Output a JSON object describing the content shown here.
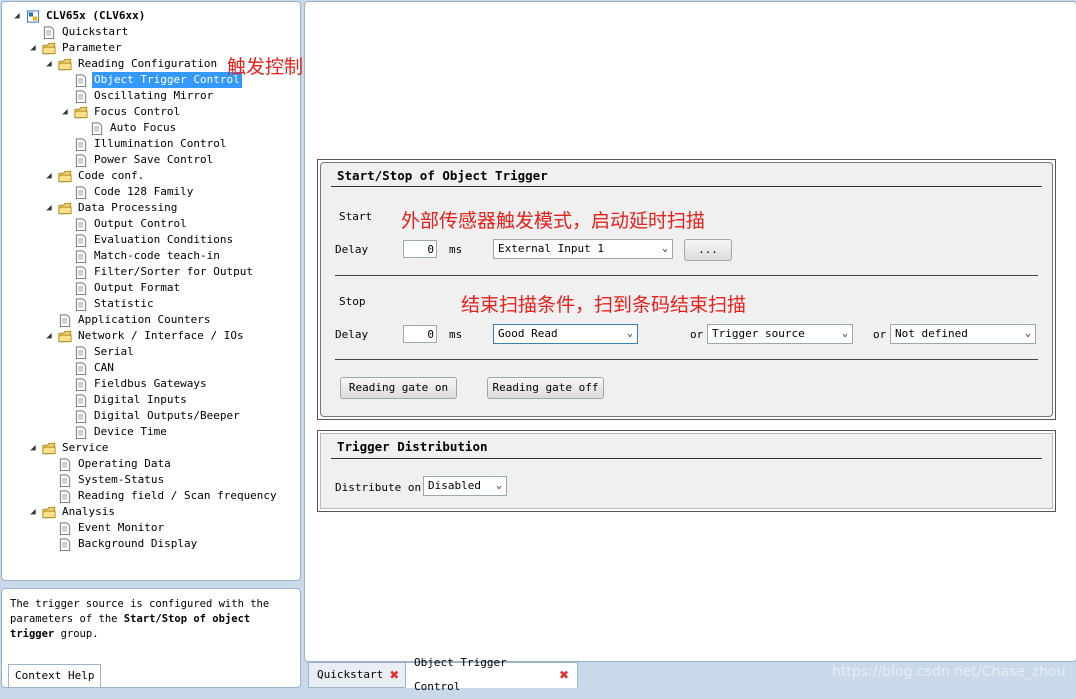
{
  "tree": [
    {
      "label": "CLV65x (CLV6xx)",
      "level": 0,
      "icon": "device-icon",
      "toggle": "expanded",
      "bold": true
    },
    {
      "label": "Quickstart",
      "level": 1,
      "icon": "page-icon",
      "toggle": "none"
    },
    {
      "label": "Parameter",
      "level": 1,
      "icon": "folder-icon",
      "toggle": "expanded"
    },
    {
      "label": "Reading Configuration",
      "level": 2,
      "icon": "folder-icon",
      "toggle": "expanded"
    },
    {
      "label": "Object Trigger Control",
      "level": 3,
      "icon": "page-icon",
      "toggle": "none",
      "selected": true
    },
    {
      "label": "Oscillating Mirror",
      "level": 3,
      "icon": "page-icon",
      "toggle": "none"
    },
    {
      "label": "Focus Control",
      "level": 3,
      "icon": "folder-icon",
      "toggle": "expanded"
    },
    {
      "label": "Auto Focus",
      "level": 4,
      "icon": "page-icon",
      "toggle": "none"
    },
    {
      "label": "Illumination Control",
      "level": 3,
      "icon": "page-icon",
      "toggle": "none"
    },
    {
      "label": "Power Save Control",
      "level": 3,
      "icon": "page-icon",
      "toggle": "none"
    },
    {
      "label": "Code conf.",
      "level": 2,
      "icon": "folder-icon",
      "toggle": "expanded"
    },
    {
      "label": "Code 128 Family",
      "level": 3,
      "icon": "page-icon",
      "toggle": "none"
    },
    {
      "label": "Data Processing",
      "level": 2,
      "icon": "folder-icon",
      "toggle": "expanded"
    },
    {
      "label": "Output Control",
      "level": 3,
      "icon": "page-icon",
      "toggle": "none"
    },
    {
      "label": "Evaluation Conditions",
      "level": 3,
      "icon": "page-icon",
      "toggle": "none"
    },
    {
      "label": "Match-code teach-in",
      "level": 3,
      "icon": "page-icon",
      "toggle": "none"
    },
    {
      "label": "Filter/Sorter for Output",
      "level": 3,
      "icon": "page-icon",
      "toggle": "none"
    },
    {
      "label": "Output Format",
      "level": 3,
      "icon": "page-icon",
      "toggle": "none"
    },
    {
      "label": "Statistic",
      "level": 3,
      "icon": "page-icon",
      "toggle": "none"
    },
    {
      "label": "Application Counters",
      "level": 2,
      "icon": "page-icon",
      "toggle": "none"
    },
    {
      "label": "Network / Interface / IOs",
      "level": 2,
      "icon": "folder-icon",
      "toggle": "expanded"
    },
    {
      "label": "Serial",
      "level": 3,
      "icon": "page-icon",
      "toggle": "none"
    },
    {
      "label": "CAN",
      "level": 3,
      "icon": "page-icon",
      "toggle": "none"
    },
    {
      "label": "Fieldbus Gateways",
      "level": 3,
      "icon": "page-icon",
      "toggle": "none"
    },
    {
      "label": "Digital Inputs",
      "level": 3,
      "icon": "page-icon",
      "toggle": "none"
    },
    {
      "label": "Digital Outputs/Beeper",
      "level": 3,
      "icon": "page-icon",
      "toggle": "none"
    },
    {
      "label": "Device Time",
      "level": 3,
      "icon": "page-icon",
      "toggle": "none"
    },
    {
      "label": "Service",
      "level": 1,
      "icon": "folder-icon",
      "toggle": "expanded"
    },
    {
      "label": "Operating Data",
      "level": 2,
      "icon": "page-icon",
      "toggle": "none"
    },
    {
      "label": "System-Status",
      "level": 2,
      "icon": "page-icon",
      "toggle": "none"
    },
    {
      "label": "Reading field / Scan frequency",
      "level": 2,
      "icon": "page-icon",
      "toggle": "none"
    },
    {
      "label": "Analysis",
      "level": 1,
      "icon": "folder-icon",
      "toggle": "expanded"
    },
    {
      "label": "Event Monitor",
      "level": 2,
      "icon": "page-icon",
      "toggle": "none"
    },
    {
      "label": "Background Display",
      "level": 2,
      "icon": "page-icon",
      "toggle": "none"
    }
  ],
  "annotations": {
    "tree_note": "触发控制",
    "start_note": "外部传感器触发模式，启动延时扫描",
    "stop_note": "结束扫描条件，扫到条码结束扫描"
  },
  "help": {
    "text_part1": "The trigger source is configured with the parameters of the ",
    "text_bold1": "Start/Stop of object trigger",
    "text_part2": " group.",
    "tab_label": "Context Help"
  },
  "start_stop": {
    "title": "Start/Stop of Object Trigger",
    "start_label": "Start",
    "start_delay_label": "Delay",
    "start_delay_value": "0",
    "start_unit": "ms",
    "start_source": "External Input 1",
    "start_more_button": "...",
    "stop_label": "Stop",
    "stop_delay_label": "Delay",
    "stop_delay_value": "0",
    "stop_unit": "ms",
    "stop_condition1": "Good Read",
    "or1": "or",
    "stop_condition2": "Trigger source",
    "or2": "or",
    "stop_condition3": "Not defined",
    "gate_on_button": "Reading gate on",
    "gate_off_button": "Reading gate off"
  },
  "distribution": {
    "title": "Trigger Distribution",
    "label": "Distribute on",
    "value": "Disabled"
  },
  "bottom_tabs": [
    {
      "label": "Quickstart",
      "active": false
    },
    {
      "label": "Object Trigger Control",
      "active": true
    }
  ],
  "watermark": "https://blog.csdn.net/Chase_zhou",
  "colors": {
    "selection": "#3399ff",
    "annotation": "#e8201c",
    "close": "#dd3333"
  }
}
